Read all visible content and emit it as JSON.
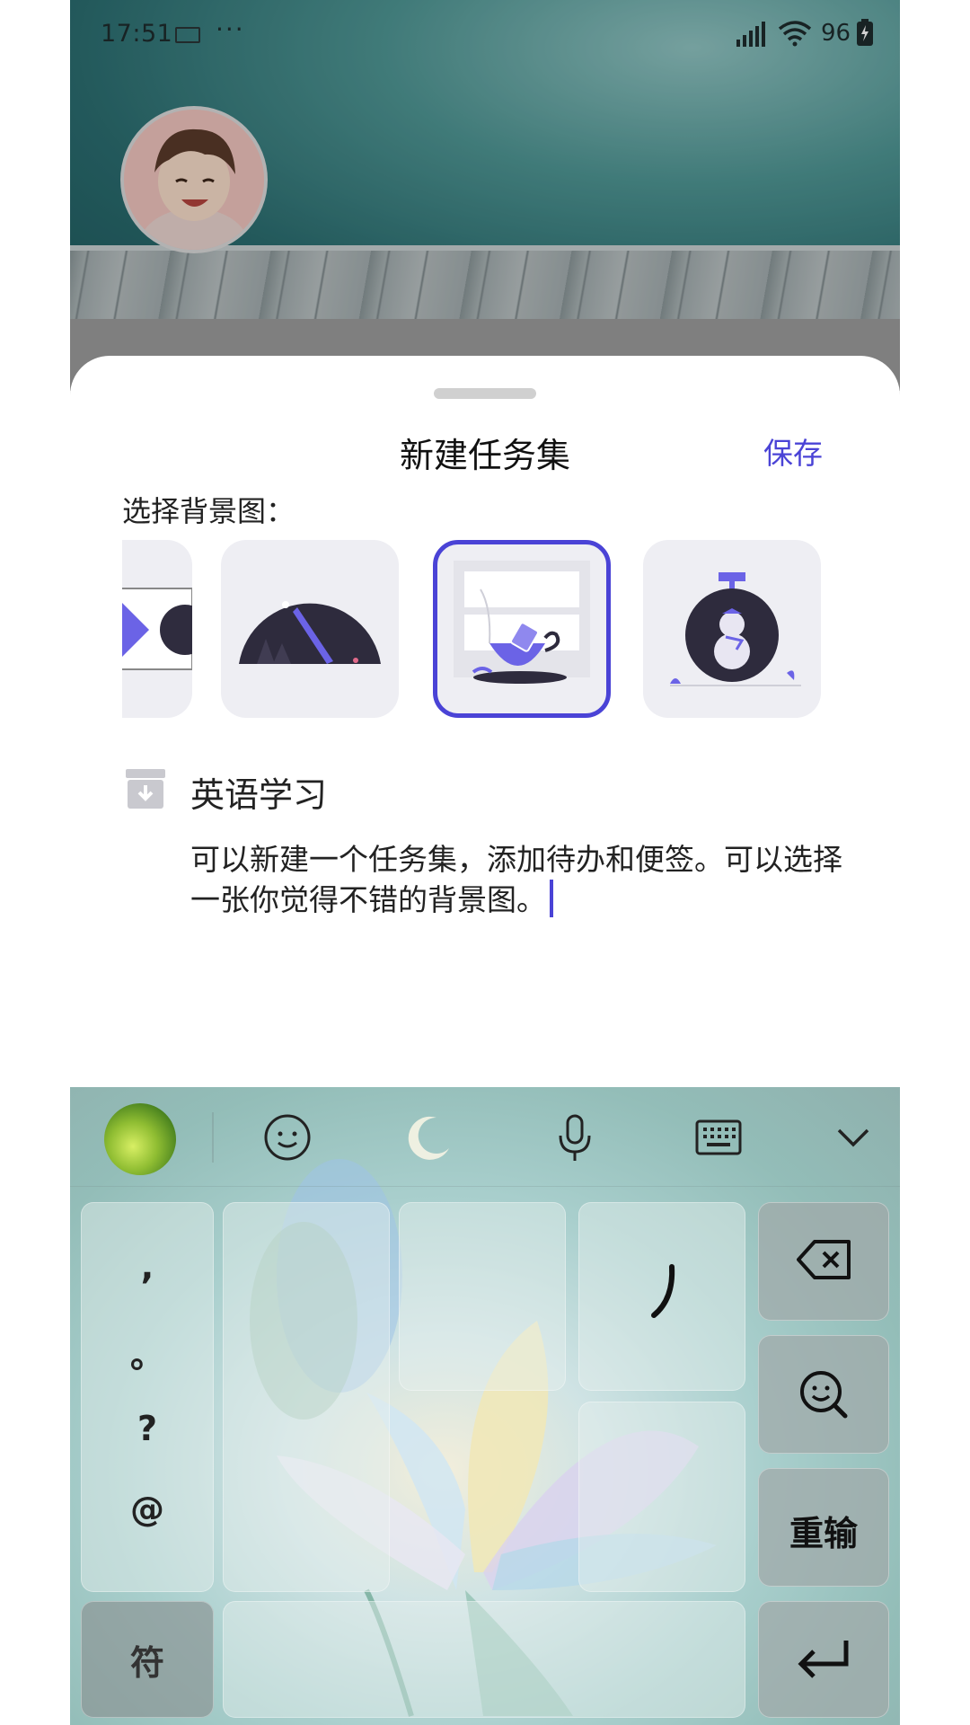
{
  "status_bar": {
    "time": "17:51",
    "dots": "···",
    "battery": "96"
  },
  "sheet": {
    "title": "新建任务集",
    "save_label": "保存",
    "bg_label": "选择背景图：",
    "task_name": "英语学习",
    "task_desc": "可以新建一个任务集，添加待办和便签。可以选择一张你觉得不错的背景图。"
  },
  "keyboard": {
    "punct": [
      ",",
      "。",
      "?",
      "@"
    ],
    "symbols_label": "符",
    "reset_label": "重输"
  },
  "colors": {
    "accent": "#4a43d6",
    "header_teal": "#2b6d70"
  },
  "icons": [
    "keyboard-status-icon",
    "signal-icon",
    "wifi-icon",
    "battery-icon",
    "archive-icon",
    "emoji-icon",
    "mic-icon",
    "keyboard-icon",
    "chevron-down-icon",
    "backspace-icon",
    "emoji-search-icon",
    "enter-icon"
  ]
}
